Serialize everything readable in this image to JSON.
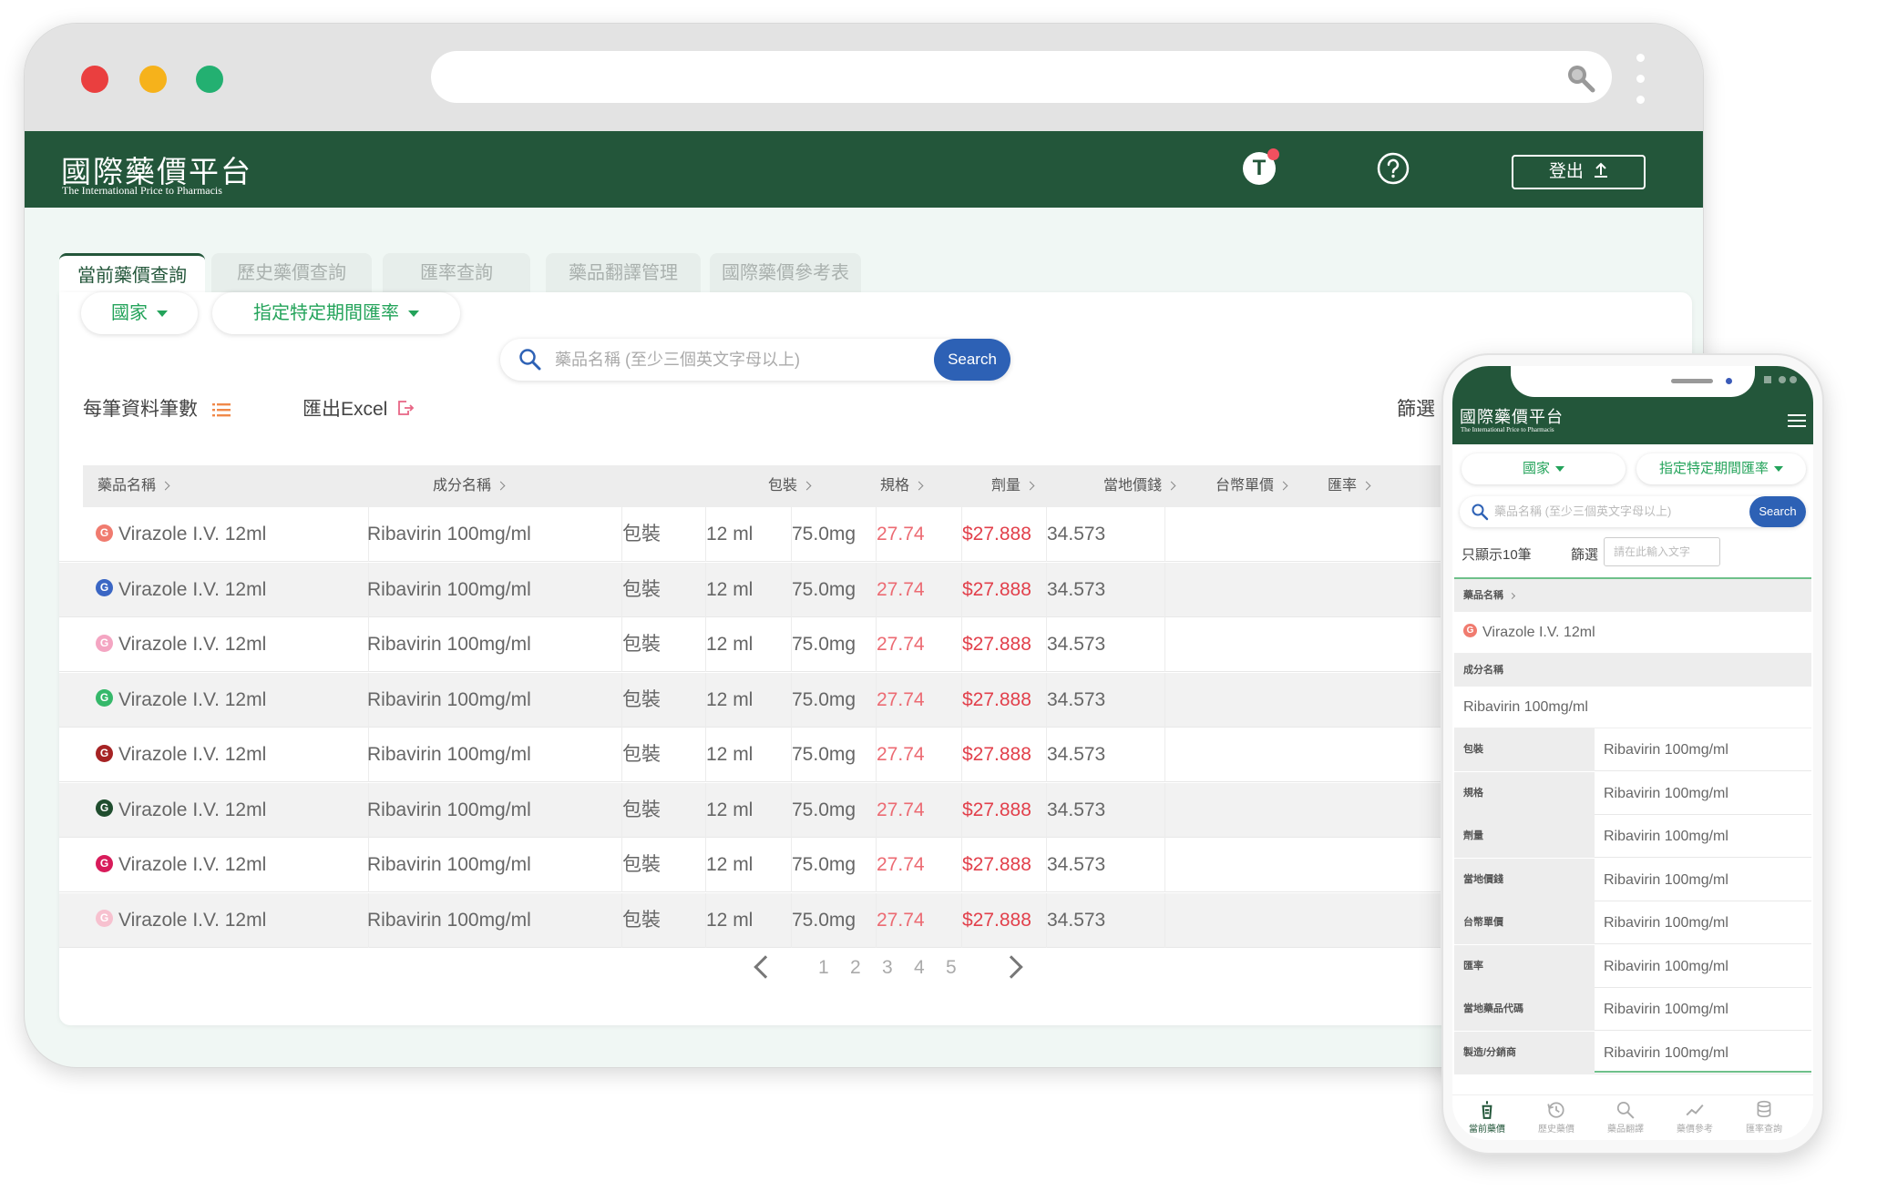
{
  "header": {
    "logo_title": "國際藥價平台",
    "logo_subtitle": "The International Price to Pharmacis",
    "user_initial": "T",
    "logout_label": "登出"
  },
  "tabs": [
    {
      "label": "當前藥價查詢",
      "active": true
    },
    {
      "label": "歷史藥價查詢",
      "active": false
    },
    {
      "label": "匯率查詢",
      "active": false
    },
    {
      "label": "藥品翻譯管理",
      "active": false
    },
    {
      "label": "國際藥價參考表",
      "active": false
    }
  ],
  "filters": {
    "country_label": "國家",
    "rate_label": "指定特定期間匯率",
    "search_placeholder": "藥品名稱 (至少三個英文字母以上)",
    "search_button": "Search"
  },
  "toolbar": {
    "per_page_label": "每筆資料筆數",
    "export_label": "匯出Excel",
    "filter_label": "篩選"
  },
  "table": {
    "columns": [
      "藥品名稱",
      "成分名稱",
      "包裝",
      "規格",
      "劑量",
      "當地價錢",
      "台幣單價",
      "匯率"
    ],
    "rows": [
      {
        "badge_color": "#f07b6f",
        "name": "Virazole I.V. 12ml",
        "ingredient": "Ribavirin 100mg/ml",
        "package": "包裝",
        "spec": "12 ml",
        "dose": "75.0mg",
        "local_price": "27.74",
        "twd_price": "$27.888",
        "rate": "34.573"
      },
      {
        "badge_color": "#3a66c4",
        "name": "Virazole I.V. 12ml",
        "ingredient": "Ribavirin 100mg/ml",
        "package": "包裝",
        "spec": "12 ml",
        "dose": "75.0mg",
        "local_price": "27.74",
        "twd_price": "$27.888",
        "rate": "34.573"
      },
      {
        "badge_color": "#f4a5c2",
        "name": "Virazole I.V. 12ml",
        "ingredient": "Ribavirin 100mg/ml",
        "package": "包裝",
        "spec": "12 ml",
        "dose": "75.0mg",
        "local_price": "27.74",
        "twd_price": "$27.888",
        "rate": "34.573"
      },
      {
        "badge_color": "#35b86a",
        "name": "Virazole I.V. 12ml",
        "ingredient": "Ribavirin 100mg/ml",
        "package": "包裝",
        "spec": "12 ml",
        "dose": "75.0mg",
        "local_price": "27.74",
        "twd_price": "$27.888",
        "rate": "34.573"
      },
      {
        "badge_color": "#a62324",
        "name": "Virazole I.V. 12ml",
        "ingredient": "Ribavirin 100mg/ml",
        "package": "包裝",
        "spec": "12 ml",
        "dose": "75.0mg",
        "local_price": "27.74",
        "twd_price": "$27.888",
        "rate": "34.573"
      },
      {
        "badge_color": "#1f4d2e",
        "name": "Virazole I.V. 12ml",
        "ingredient": "Ribavirin 100mg/ml",
        "package": "包裝",
        "spec": "12 ml",
        "dose": "75.0mg",
        "local_price": "27.74",
        "twd_price": "$27.888",
        "rate": "34.573"
      },
      {
        "badge_color": "#d81b5a",
        "name": "Virazole I.V. 12ml",
        "ingredient": "Ribavirin 100mg/ml",
        "package": "包裝",
        "spec": "12 ml",
        "dose": "75.0mg",
        "local_price": "27.74",
        "twd_price": "$27.888",
        "rate": "34.573"
      },
      {
        "badge_color": "#f7c1cf",
        "name": "Virazole I.V. 12ml",
        "ingredient": "Ribavirin 100mg/ml",
        "package": "包裝",
        "spec": "12 ml",
        "dose": "75.0mg",
        "local_price": "27.74",
        "twd_price": "$27.888",
        "rate": "34.573"
      }
    ],
    "badge_letter": "G"
  },
  "pagination": {
    "pages": [
      "1",
      "2",
      "3",
      "4",
      "5"
    ]
  },
  "mobile": {
    "title": "國際藥價平台",
    "subtitle": "The International Price to Pharmacis",
    "country_label": "國家",
    "rate_label": "指定特定期間匯率",
    "search_placeholder": "藥品名稱 (至少三個英文字母以上)",
    "search_button": "Search",
    "show_label": "只顯示10筆",
    "filter_label": "篩選",
    "filter_placeholder": "請在此輸入文字",
    "card": {
      "name_header": "藥品名稱",
      "name_value": "Virazole I.V. 12ml",
      "badge_color": "#f07b6f",
      "ingredient_header": "成分名稱",
      "ingredient_value": "Ribavirin 100mg/ml",
      "fields": [
        {
          "key": "包裝",
          "value": "Ribavirin 100mg/ml"
        },
        {
          "key": "規格",
          "value": "Ribavirin 100mg/ml"
        },
        {
          "key": "劑量",
          "value": "Ribavirin 100mg/ml"
        },
        {
          "key": "當地價錢",
          "value": "Ribavirin 100mg/ml"
        },
        {
          "key": "台幣單價",
          "value": "Ribavirin 100mg/ml"
        },
        {
          "key": "匯率",
          "value": "Ribavirin 100mg/ml"
        },
        {
          "key": "當地藥品代碼",
          "value": "Ribavirin 100mg/ml"
        },
        {
          "key": "製造/分銷商",
          "value": "Ribavirin 100mg/ml"
        }
      ]
    },
    "nav": [
      {
        "label": "當前藥價",
        "icon": "price-tag-icon",
        "active": true
      },
      {
        "label": "歷史藥價",
        "icon": "history-icon",
        "active": false
      },
      {
        "label": "藥品翻譯",
        "icon": "search-icon",
        "active": false
      },
      {
        "label": "藥價參考",
        "icon": "trend-icon",
        "active": false
      },
      {
        "label": "匯率查詢",
        "icon": "database-icon",
        "active": false
      }
    ]
  },
  "colors": {
    "brand_green": "#23563a",
    "accent_green": "#23a35a",
    "search_blue": "#2d61b5",
    "price_red": "#e2404b"
  }
}
